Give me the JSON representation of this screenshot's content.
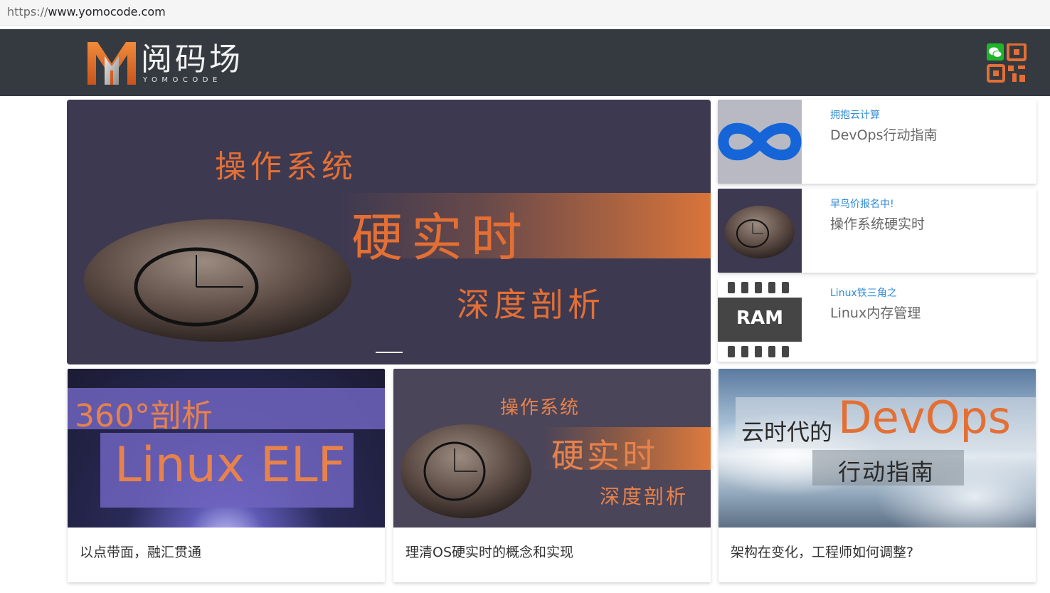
{
  "browser": {
    "url_scheme": "https://",
    "url_host": "www.yomocode.com"
  },
  "header": {
    "logo_text": "阅码场",
    "logo_subtitle": "YOMOCODE",
    "qr_icon": "wechat-qr-icon"
  },
  "hero": {
    "line1": "操作系统",
    "line2": "硬实时",
    "line3": "深度剖析"
  },
  "side_cards": [
    {
      "tag": "拥抱云计算",
      "title": "DevOps行动指南",
      "thumb_icon": "devops-infinity-icon"
    },
    {
      "tag": "早鸟价报名中!",
      "title": "操作系统硬实时",
      "thumb_icon": "stone-clock-icon"
    },
    {
      "tag": "Linux铁三角之",
      "title": "Linux内存管理",
      "thumb_icon": "ram-chip-icon",
      "thumb_label": "RAM"
    }
  ],
  "cards": [
    {
      "img_line1": "360°剖析",
      "img_line2": "Linux ELF",
      "caption": "以点带面，融汇贯通"
    },
    {
      "img_line1": "操作系统",
      "img_line2": "硬实时",
      "img_line3": "深度剖析",
      "caption": "理清OS硬实时的概念和实现"
    },
    {
      "img_line1": "云时代的",
      "img_line2": "DevOps",
      "img_line3": "行动指南",
      "caption": "架构在变化，工程师如何调整?"
    }
  ],
  "colors": {
    "navbar": "#343a40",
    "accent_orange": "#e36f35",
    "tag_blue": "#2f8ad6"
  }
}
